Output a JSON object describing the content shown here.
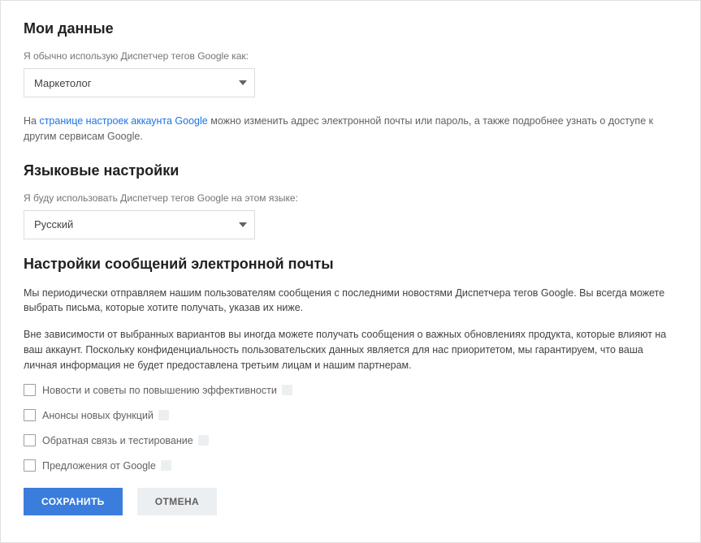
{
  "my_data": {
    "heading": "Мои данные",
    "role_label": "Я обычно использую Диспетчер тегов Google как:",
    "role_value": "Маркетолог",
    "info_prefix": "На ",
    "info_link": "странице настроек аккаунта Google",
    "info_suffix": " можно изменить адрес электронной почты или пароль, а также подробнее узнать о доступе к другим сервисам Google."
  },
  "language": {
    "heading": "Языковые настройки",
    "label": "Я буду использовать Диспетчер тегов Google на этом языке:",
    "value": "Русский"
  },
  "email": {
    "heading": "Настройки сообщений электронной почты",
    "para1": "Мы периодически отправляем нашим пользователям сообщения с последними новостями Диспетчера тегов Google. Вы всегда можете выбрать письма, которые хотите получать, указав их ниже.",
    "para2": "Вне зависимости от выбранных вариантов вы иногда можете получать сообщения о важных обновлениях продукта, которые влияют на ваш аккаунт. Поскольку конфиденциальность пользовательских данных является для нас приоритетом, мы гарантируем, что ваша личная информация не будет предоставлена третьим лицам и нашим партнерам.",
    "options": [
      "Новости и советы по повышению эффективности",
      "Анонсы новых функций",
      "Обратная связь и тестирование",
      "Предложения от Google"
    ]
  },
  "buttons": {
    "save": "СОХРАНИТЬ",
    "cancel": "ОТМЕНА"
  }
}
